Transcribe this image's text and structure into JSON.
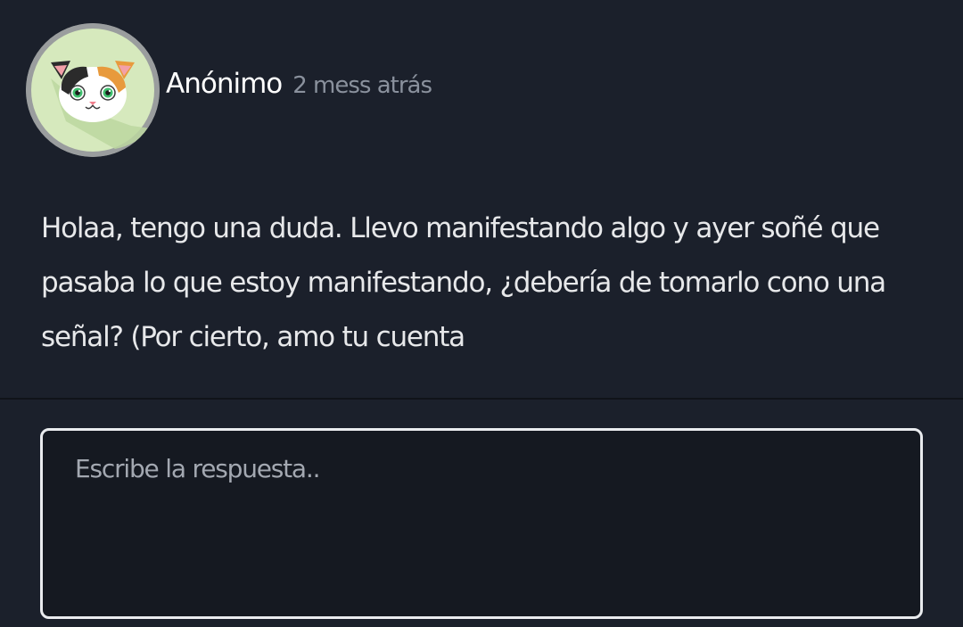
{
  "question": {
    "author": "Anónimo",
    "timestamp": "2 mess atrás",
    "text": "Holaa, tengo una duda. Llevo manifestando algo y ayer soñé que pasaba lo que estoy manifestando, ¿debería de tomarlo cono una señal? (Por cierto, amo tu cuenta"
  },
  "answer": {
    "placeholder": "Escribe la respuesta.."
  },
  "avatar": {
    "icon": "calico-cat-icon",
    "ring_color": "#9a9d9e",
    "background_color": "#d6e9bd"
  }
}
